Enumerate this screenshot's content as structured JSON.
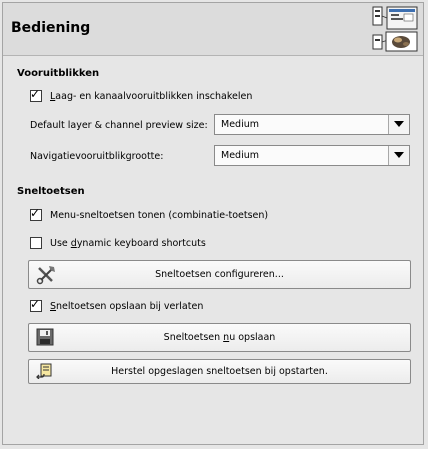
{
  "header": {
    "title": "Bediening",
    "icon": "input-devices-icon"
  },
  "section_preview": {
    "title": "Vooruitblikken",
    "enable_previews": {
      "label_underlined": "L",
      "label_rest": "aag- en kanaalvooruitblikken inschakelen",
      "checked": true
    },
    "preview_size": {
      "label": "Default layer & channel preview size:",
      "value": "Medium"
    },
    "nav_preview_size": {
      "label": "Navigatievooruitblikgrootte:",
      "value": "Medium"
    }
  },
  "section_shortcuts": {
    "title": "Sneltoetsen",
    "show_menu_shortcuts": {
      "label": "Menu-sneltoetsen tonen (combinatie-toetsen)",
      "checked": true
    },
    "dynamic_shortcuts": {
      "label_before": "Use ",
      "label_underlined": "d",
      "label_after": "ynamic keyboard shortcuts",
      "checked": false
    },
    "configure_button": {
      "label": "Sneltoetsen configureren...",
      "icon": "tools-icon"
    },
    "save_on_exit": {
      "label_underlined": "S",
      "label_rest": "neltoetsen opslaan bij verlaten",
      "checked": true
    },
    "save_now_button": {
      "label_before": "Sneltoetsen ",
      "label_underlined": "n",
      "label_after": "u opslaan",
      "icon": "floppy-disk-icon"
    },
    "reset_button": {
      "label": "Herstel opgeslagen sneltoetsen bij opstarten.",
      "icon": "revert-icon"
    }
  }
}
